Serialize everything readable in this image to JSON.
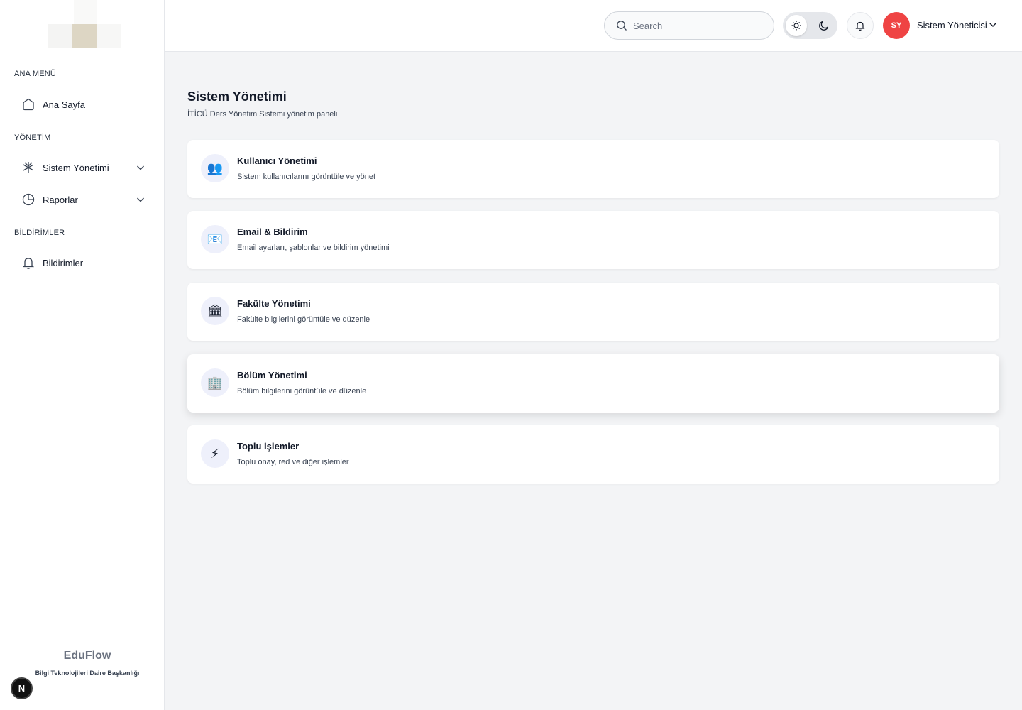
{
  "sidebar": {
    "sections": [
      {
        "label": "ANA MENÜ"
      },
      {
        "label": "YÖNETİM"
      },
      {
        "label": "BİLDİRİMLER"
      }
    ],
    "items": [
      {
        "label": "Ana Sayfa",
        "icon": "home-icon"
      },
      {
        "label": "Sistem Yönetimi",
        "icon": "system-icon"
      },
      {
        "label": "Raporlar",
        "icon": "pie-chart-icon"
      },
      {
        "label": "Bildirimler",
        "icon": "bell-icon"
      }
    ],
    "brand": {
      "name": "EduFlow",
      "subtitle": "Bilgi Teknolojileri Daire Başkanlığı"
    },
    "badge": "N"
  },
  "header": {
    "search_placeholder": "Search",
    "avatar_initials": "SY",
    "avatar_color": "#ef4444",
    "user_name": "Sistem Yöneticisi"
  },
  "main": {
    "title": "Sistem Yönetimi",
    "subtitle": "İTİCÜ Ders Yönetim Sistemi yönetim paneli",
    "cards": [
      {
        "icon": "👥",
        "icon_name": "users-icon",
        "title": "Kullanıcı Yönetimi",
        "desc": "Sistem kullanıcılarını görüntüle ve yönet"
      },
      {
        "icon": "📧",
        "icon_name": "email-icon",
        "title": "Email & Bildirim",
        "desc": "Email ayarları, şablonlar ve bildirim yönetimi"
      },
      {
        "icon": "🏛",
        "icon_name": "building-icon",
        "title": "Fakülte Yönetimi",
        "desc": "Fakülte bilgilerini görüntüle ve düzenle"
      },
      {
        "icon": "🏢",
        "icon_name": "office-icon",
        "title": "Bölüm Yönetimi",
        "desc": "Bölüm bilgilerini görüntüle ve düzenle"
      },
      {
        "icon": "⚡",
        "icon_name": "lightning-icon",
        "title": "Toplu İşlemler",
        "desc": "Toplu onay, red ve diğer işlemler"
      }
    ]
  }
}
